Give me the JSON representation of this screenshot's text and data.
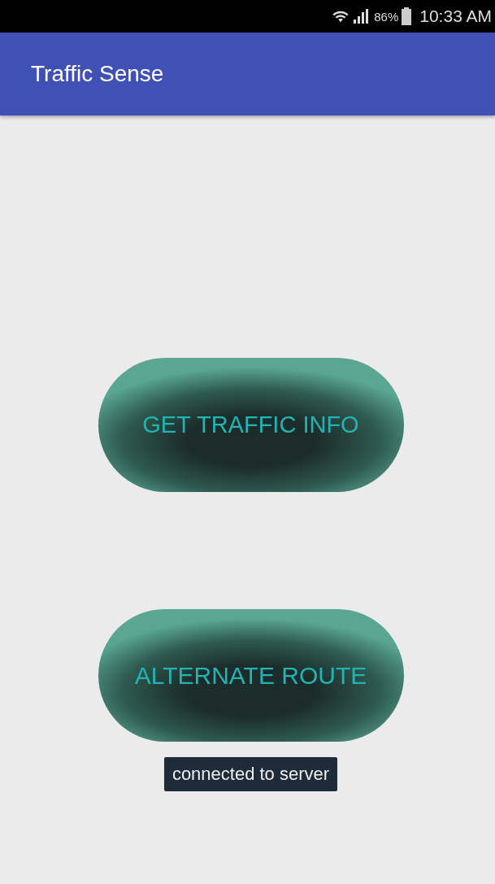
{
  "status_bar": {
    "battery": "86%",
    "time": "10:33 AM"
  },
  "app_bar": {
    "title": "Traffic Sense"
  },
  "buttons": [
    "GET TRAFFIC INFO",
    "ALTERNATE ROUTE"
  ],
  "toast": "connected to server"
}
